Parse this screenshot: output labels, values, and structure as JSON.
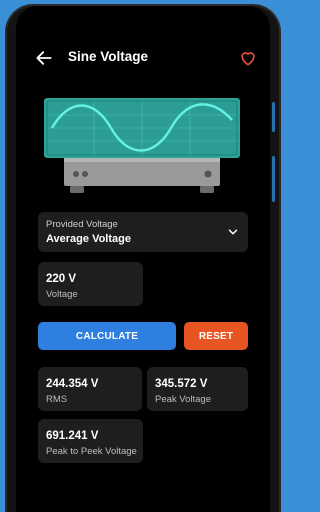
{
  "appbar": {
    "title": "Sine Voltage"
  },
  "icons": {
    "back": "arrow-left-icon",
    "favorite": "heart-outline-icon",
    "dropdown": "chevron-down-icon"
  },
  "colors": {
    "calculate": "#2f7fe0",
    "reset": "#e75622",
    "heart": "#e74c3c",
    "wave": "#2fe0d0"
  },
  "input": {
    "select_label": "Provided Voltage",
    "select_value": "Average Voltage",
    "value": "220 V",
    "value_label": "Voltage"
  },
  "buttons": {
    "calculate": "CALCULATE",
    "reset": "RESET"
  },
  "results": [
    {
      "value": "244.354 V",
      "label": "RMS"
    },
    {
      "value": "345.572 V",
      "label": "Peak Voltage"
    },
    {
      "value": "691.241 V",
      "label": "Peak to Peek Voltage"
    }
  ]
}
